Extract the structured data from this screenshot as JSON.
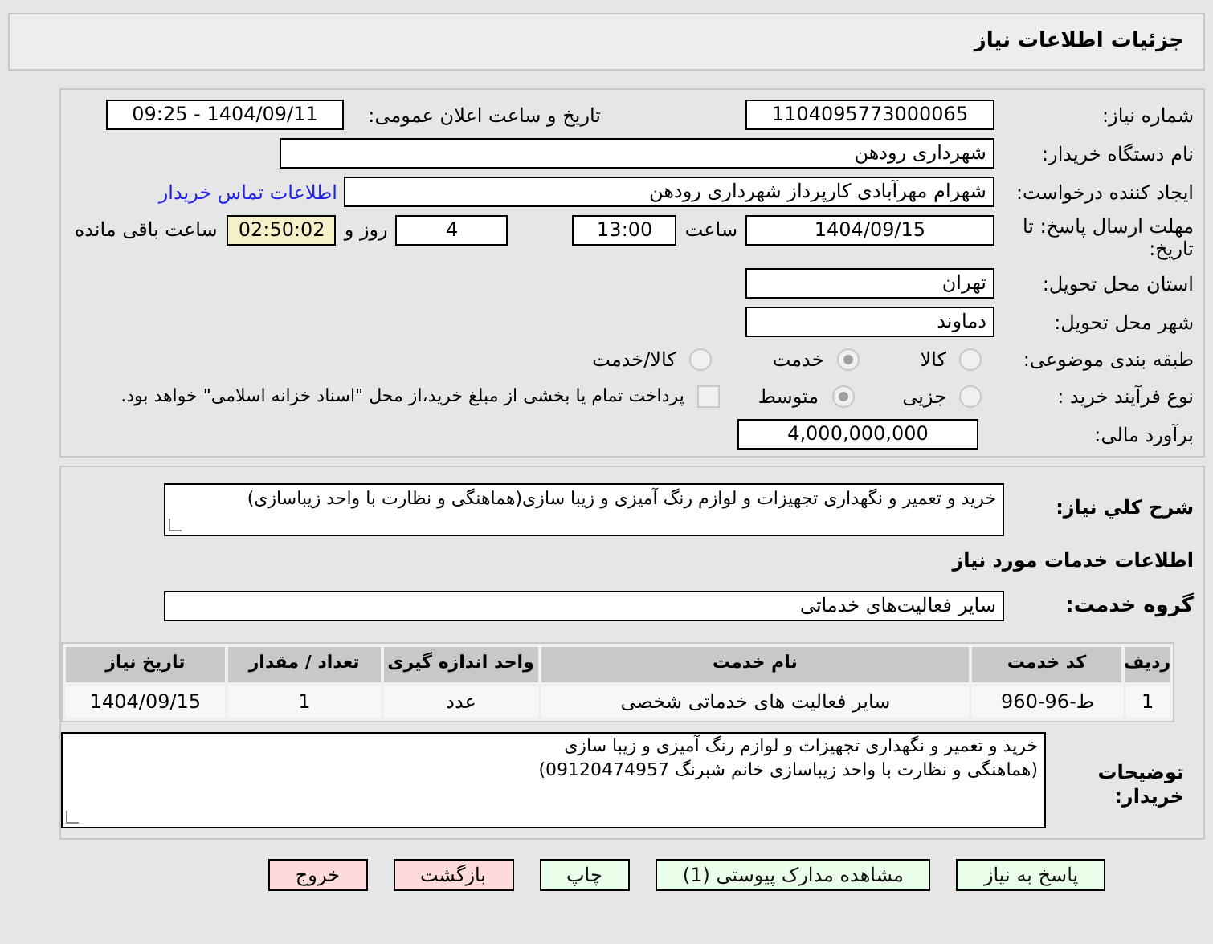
{
  "header": {
    "title": "جزئیات اطلاعات نیاز"
  },
  "details": {
    "need_number": {
      "label": "شماره نیاز:",
      "value": "1104095773000065"
    },
    "announce": {
      "label": "تاریخ و ساعت اعلان عمومی:",
      "value": "1404/09/11 - 09:25"
    },
    "buyer": {
      "label": "نام دستگاه خریدار:",
      "value": "شهرداری رودهن"
    },
    "creator": {
      "label": "ایجاد کننده درخواست:",
      "value": "شهرام مهرآبادی کارپرداز شهرداری رودهن",
      "link": "اطلاعات تماس خریدار"
    },
    "deadline": {
      "label": "مهلت ارسال پاسخ: تا تاریخ:",
      "date": "1404/09/15",
      "time_label": "ساعت",
      "time": "13:00",
      "days": "4",
      "days_label": "روز و",
      "remaining": "02:50:02",
      "remaining_label": "ساعت باقی مانده"
    },
    "province": {
      "label": "استان محل تحویل:",
      "value": "تهران"
    },
    "city": {
      "label": "شهر محل تحویل:",
      "value": "دماوند"
    },
    "category": {
      "label": "طبقه بندی موضوعی:",
      "options": [
        {
          "label": "کالا",
          "selected": false
        },
        {
          "label": "خدمت",
          "selected": true
        },
        {
          "label": "کالا/خدمت",
          "selected": false
        }
      ]
    },
    "process": {
      "label": "نوع فرآیند خرید :",
      "options": [
        {
          "label": "جزیی",
          "selected": false
        },
        {
          "label": "متوسط",
          "selected": true
        }
      ],
      "treasury": {
        "label": "پرداخت تمام یا بخشی از مبلغ خرید،از محل \"اسناد خزانه اسلامی\" خواهد بود.",
        "checked": false
      }
    },
    "budget": {
      "label": "برآورد مالی:",
      "value": "4,000,000,000"
    }
  },
  "services": {
    "description": {
      "label": "شرح کلي نیاز:",
      "value": "خرید و تعمیر و نگهداری تجهیزات و لوازم رنگ آمیزی و زیبا سازی(هماهنگی و نظارت با واحد زیباسازی)"
    },
    "heading": "اطلاعات خدمات مورد نیاز",
    "group": {
      "label": "گروه خدمت:",
      "value": "سایر فعالیت‌های خدماتی"
    },
    "table": {
      "columns": [
        "ردیف",
        "کد خدمت",
        "نام خدمت",
        "واحد اندازه گیری",
        "تعداد / مقدار",
        "تاریخ نیاز"
      ],
      "rows": [
        [
          "1",
          "ط-96-960",
          "سایر فعالیت های خدماتی شخصی",
          "عدد",
          "1",
          "1404/09/15"
        ]
      ]
    },
    "notes": {
      "label": "توضیحات خریدار:",
      "lines": [
        "خرید و تعمیر و نگهداری تجهیزات و لوازم رنگ آمیزی و زیبا سازی",
        "(هماهنگی و نظارت با واحد زیباسازی خانم شبرنگ 09120474957)"
      ]
    }
  },
  "buttons": [
    {
      "label": "پاسخ به نیاز",
      "kind": "primary"
    },
    {
      "label": "مشاهده مدارک پیوستی (1)",
      "kind": "primary"
    },
    {
      "label": "چاپ",
      "kind": "primary"
    },
    {
      "label": "بازگشت",
      "kind": "danger"
    },
    {
      "label": "خروج",
      "kind": "danger"
    }
  ]
}
